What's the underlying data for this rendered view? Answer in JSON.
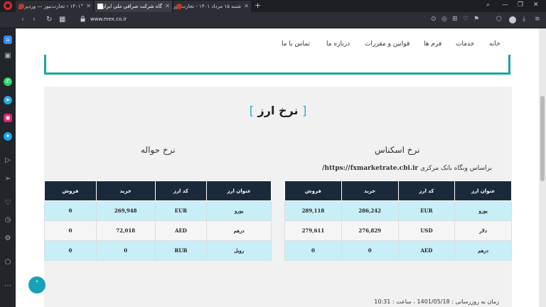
{
  "browser": {
    "tabs": [
      {
        "title": "۱۴۰۱° › تجارت‌نیوز — ورد‌پرس",
        "favicon_color": "#c0392b"
      },
      {
        "title": "گاه شرکت صرافی ملی ایران",
        "favicon_color": "#ffffff"
      },
      {
        "title": "شنبه ۱۵ مرداد ۱۴۰۱ - تجارت‌نیوز",
        "favicon_color": "#c0392b"
      }
    ],
    "new_tab": "+",
    "url": "www.mex.co.ir"
  },
  "site_nav": {
    "items": [
      "خانه",
      "خدمات",
      "فرم ها",
      "قوانین و مقررات",
      "درباره ما",
      "تماس با ما"
    ]
  },
  "main": {
    "title_bracket_open": "[",
    "title": "نرخ ارز",
    "title_bracket_close": "]",
    "cash_heading": "نرخ اسکناس",
    "transfer_heading": "نرخ حواله",
    "cbi_prefix": "براساس وبگاه بانک مرکزی",
    "cbi_url": "https://fxmarketrate.cbi.ir/",
    "updated": "زمان به روزرسانی : 1401/05/18 ، ساعت : 10:31"
  },
  "cash_table": {
    "headers": [
      "عنوان ارز",
      "کد ارز",
      "خرید",
      "فروش"
    ],
    "rows": [
      [
        "یورو",
        "EUR",
        "286,242",
        "289,118"
      ],
      [
        "دلار",
        "USD",
        "276,829",
        "279,611"
      ],
      [
        "درهم",
        "AED",
        "0",
        "0"
      ]
    ]
  },
  "transfer_table": {
    "headers": [
      "عنوان ارز",
      "کد ارز",
      "خرید",
      "فروش"
    ],
    "rows": [
      [
        "یورو",
        "EUR",
        "269,948",
        "0"
      ],
      [
        "درهم",
        "AED",
        "72,018",
        "0"
      ],
      [
        "روبل",
        "RUB",
        "0",
        "0"
      ]
    ]
  },
  "colors": {
    "accent": "#1aa7a0",
    "table_header": "#1b2a3a",
    "row_highlight": "#c8eef7",
    "scroll_top": "#17a2b8"
  }
}
